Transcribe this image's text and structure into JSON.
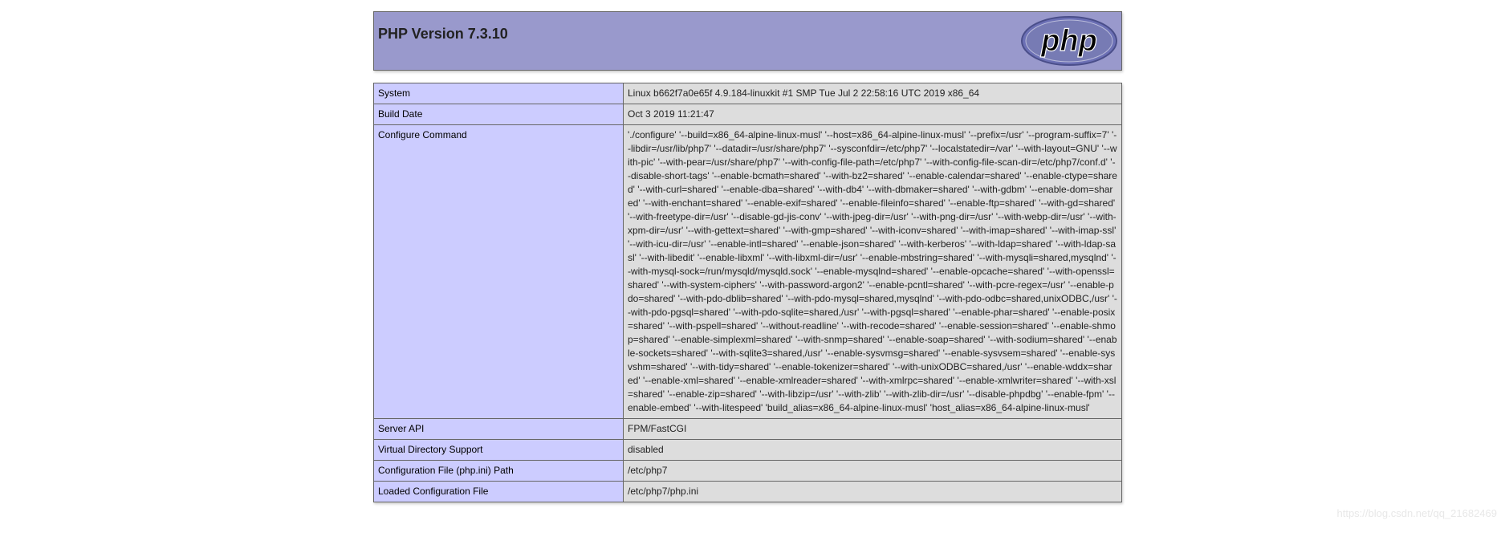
{
  "header": {
    "title": "PHP Version 7.3.10",
    "logo_text": "php"
  },
  "rows": [
    {
      "label": "System",
      "value": "Linux b662f7a0e65f 4.9.184-linuxkit #1 SMP Tue Jul 2 22:58:16 UTC 2019 x86_64"
    },
    {
      "label": "Build Date",
      "value": "Oct 3 2019 11:21:47"
    },
    {
      "label": "Configure Command",
      "value": "'./configure' '--build=x86_64-alpine-linux-musl' '--host=x86_64-alpine-linux-musl' '--prefix=/usr' '--program-suffix=7' '--libdir=/usr/lib/php7' '--datadir=/usr/share/php7' '--sysconfdir=/etc/php7' '--localstatedir=/var' '--with-layout=GNU' '--with-pic' '--with-pear=/usr/share/php7' '--with-config-file-path=/etc/php7' '--with-config-file-scan-dir=/etc/php7/conf.d' '--disable-short-tags' '--enable-bcmath=shared' '--with-bz2=shared' '--enable-calendar=shared' '--enable-ctype=shared' '--with-curl=shared' '--enable-dba=shared' '--with-db4' '--with-dbmaker=shared' '--with-gdbm' '--enable-dom=shared' '--with-enchant=shared' '--enable-exif=shared' '--enable-fileinfo=shared' '--enable-ftp=shared' '--with-gd=shared' '--with-freetype-dir=/usr' '--disable-gd-jis-conv' '--with-jpeg-dir=/usr' '--with-png-dir=/usr' '--with-webp-dir=/usr' '--with-xpm-dir=/usr' '--with-gettext=shared' '--with-gmp=shared' '--with-iconv=shared' '--with-imap=shared' '--with-imap-ssl' '--with-icu-dir=/usr' '--enable-intl=shared' '--enable-json=shared' '--with-kerberos' '--with-ldap=shared' '--with-ldap-sasl' '--with-libedit' '--enable-libxml' '--with-libxml-dir=/usr' '--enable-mbstring=shared' '--with-mysqli=shared,mysqlnd' '--with-mysql-sock=/run/mysqld/mysqld.sock' '--enable-mysqlnd=shared' '--enable-opcache=shared' '--with-openssl=shared' '--with-system-ciphers' '--with-password-argon2' '--enable-pcntl=shared' '--with-pcre-regex=/usr' '--enable-pdo=shared' '--with-pdo-dblib=shared' '--with-pdo-mysql=shared,mysqlnd' '--with-pdo-odbc=shared,unixODBC,/usr' '--with-pdo-pgsql=shared' '--with-pdo-sqlite=shared,/usr' '--with-pgsql=shared' '--enable-phar=shared' '--enable-posix=shared' '--with-pspell=shared' '--without-readline' '--with-recode=shared' '--enable-session=shared' '--enable-shmop=shared' '--enable-simplexml=shared' '--with-snmp=shared' '--enable-soap=shared' '--with-sodium=shared' '--enable-sockets=shared' '--with-sqlite3=shared,/usr' '--enable-sysvmsg=shared' '--enable-sysvsem=shared' '--enable-sysvshm=shared' '--with-tidy=shared' '--enable-tokenizer=shared' '--with-unixODBC=shared,/usr' '--enable-wddx=shared' '--enable-xml=shared' '--enable-xmlreader=shared' '--with-xmlrpc=shared' '--enable-xmlwriter=shared' '--with-xsl=shared' '--enable-zip=shared' '--with-libzip=/usr' '--with-zlib' '--with-zlib-dir=/usr' '--disable-phpdbg' '--enable-fpm' '--enable-embed' '--with-litespeed' 'build_alias=x86_64-alpine-linux-musl' 'host_alias=x86_64-alpine-linux-musl'"
    },
    {
      "label": "Server API",
      "value": "FPM/FastCGI"
    },
    {
      "label": "Virtual Directory Support",
      "value": "disabled"
    },
    {
      "label": "Configuration File (php.ini) Path",
      "value": "/etc/php7"
    },
    {
      "label": "Loaded Configuration File",
      "value": "/etc/php7/php.ini"
    }
  ],
  "watermark": "https://blog.csdn.net/qq_21682469",
  "colors": {
    "header_bg": "#9999cc",
    "label_bg": "#ccccff",
    "value_bg": "#dddddd",
    "border": "#666666"
  }
}
